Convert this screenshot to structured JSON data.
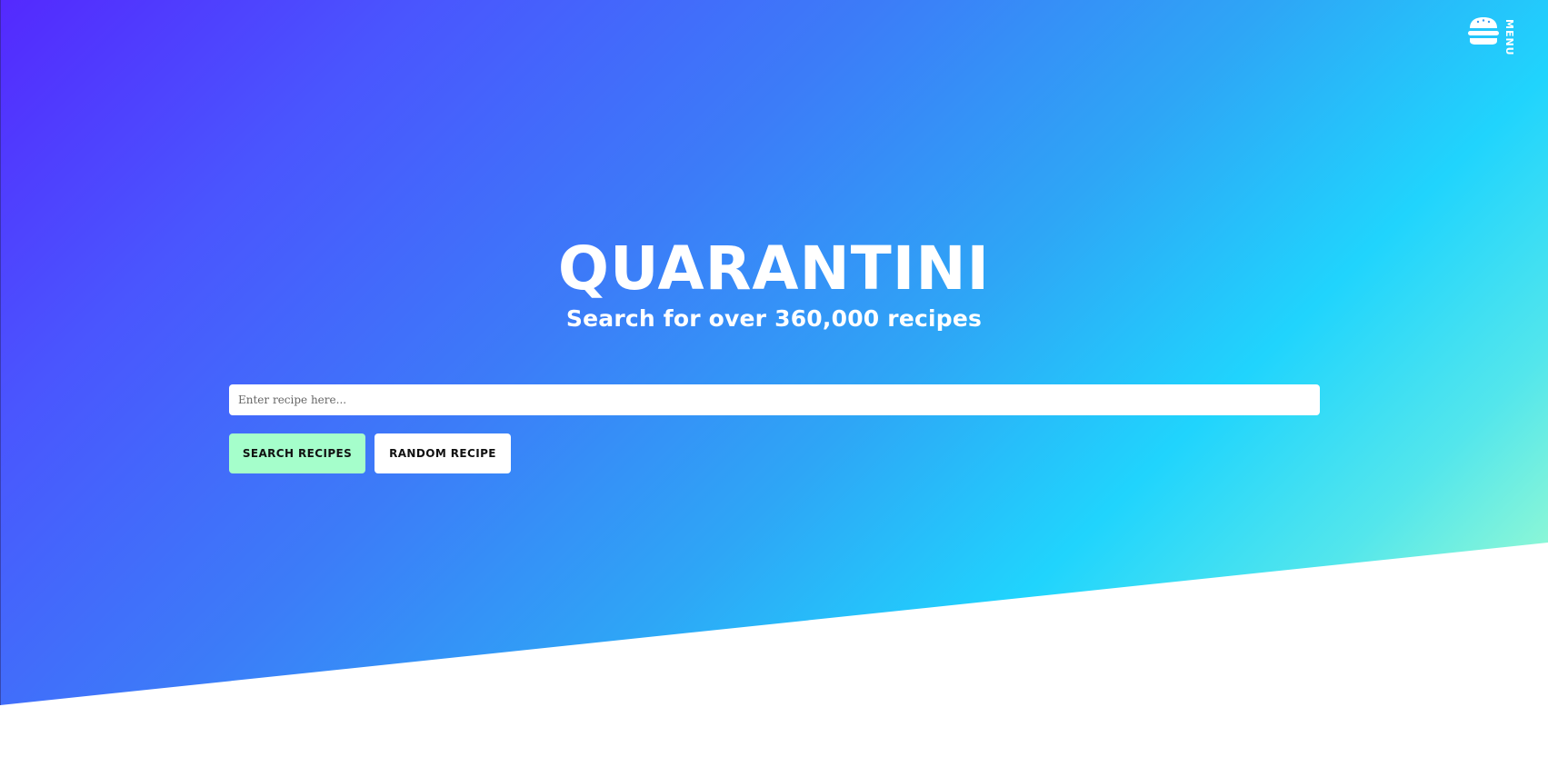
{
  "menu": {
    "label": "MENU",
    "icon": "burger-icon"
  },
  "hero": {
    "title": "QUARANTINI",
    "subtitle": "Search for over 360,000 recipes"
  },
  "search": {
    "placeholder": "Enter recipe here...",
    "value": ""
  },
  "buttons": {
    "search_label": "SEARCH RECIPES",
    "random_label": "RANDOM RECIPE"
  },
  "colors": {
    "gradient_start": "#5429fe",
    "gradient_mid": "#20d4fd",
    "gradient_end": "#a9ffcb",
    "search_button": "#a5fecb",
    "random_button": "#ffffff"
  }
}
